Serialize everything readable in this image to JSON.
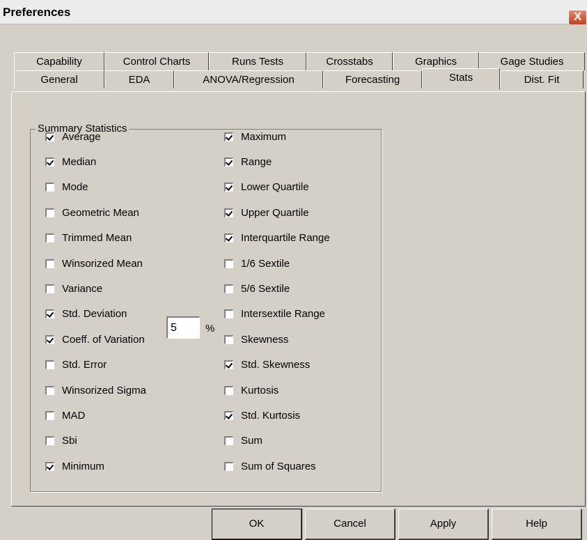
{
  "window": {
    "title": "Preferences",
    "close_label": "X"
  },
  "tabs_row1": [
    "Capability",
    "Control Charts",
    "Runs Tests",
    "Crosstabs",
    "Graphics",
    "Gage Studies"
  ],
  "tabs_row2": [
    "General",
    "EDA",
    "ANOVA/Regression",
    "Forecasting",
    "Stats",
    "Dist. Fit"
  ],
  "active_tab": "Stats",
  "group": {
    "title": "Summary Statistics",
    "left": [
      {
        "label": "Average",
        "checked": true
      },
      {
        "label": "Median",
        "checked": true
      },
      {
        "label": "Mode",
        "checked": false
      },
      {
        "label": "Geometric Mean",
        "checked": false
      },
      {
        "label": "Trimmed Mean",
        "checked": false
      },
      {
        "label": "Winsorized Mean",
        "checked": false
      },
      {
        "label": "Variance",
        "checked": false
      },
      {
        "label": "Std. Deviation",
        "checked": true
      },
      {
        "label": "Coeff. of Variation",
        "checked": true
      },
      {
        "label": "Std. Error",
        "checked": false
      },
      {
        "label": "Winsorized Sigma",
        "checked": false
      },
      {
        "label": "MAD",
        "checked": false
      },
      {
        "label": "Sbi",
        "checked": false
      },
      {
        "label": "Minimum",
        "checked": true
      }
    ],
    "right": [
      {
        "label": "Maximum",
        "checked": true
      },
      {
        "label": "Range",
        "checked": true
      },
      {
        "label": "Lower Quartile",
        "checked": true
      },
      {
        "label": "Upper Quartile",
        "checked": true
      },
      {
        "label": "Interquartile Range",
        "checked": true
      },
      {
        "label": "1/6 Sextile",
        "checked": false
      },
      {
        "label": "5/6 Sextile",
        "checked": false
      },
      {
        "label": "Intersextile Range",
        "checked": false
      },
      {
        "label": "Skewness",
        "checked": false
      },
      {
        "label": "Std. Skewness",
        "checked": true
      },
      {
        "label": "Kurtosis",
        "checked": false
      },
      {
        "label": "Std. Kurtosis",
        "checked": true
      },
      {
        "label": "Sum",
        "checked": false
      },
      {
        "label": "Sum of Squares",
        "checked": false
      }
    ],
    "trimmed_percent_value": "5",
    "percent_symbol": "%"
  },
  "buttons": {
    "ok": "OK",
    "cancel": "Cancel",
    "apply": "Apply",
    "help": "Help"
  }
}
